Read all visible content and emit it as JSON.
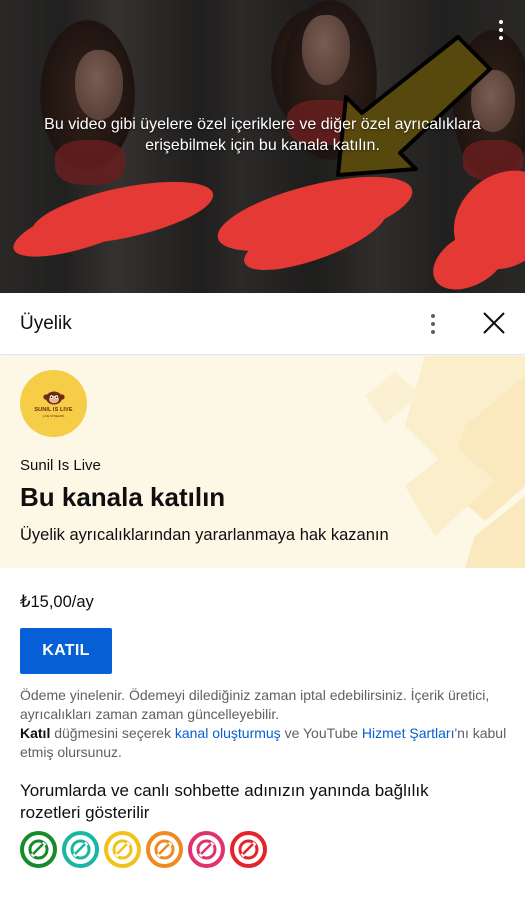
{
  "video": {
    "overlay_message": "Bu video gibi üyelere özel içeriklere ve diğer özel ayrıcalıklara erişebilmek için bu kanala katılın.",
    "more_icon": "more-vertical-icon"
  },
  "panel": {
    "title": "Üyelik",
    "more_icon": "more-vertical-icon",
    "close_icon": "close-icon"
  },
  "channel": {
    "avatar_text": "SUNIL IS LIVE",
    "avatar_subtext": "LIVE STREAMS",
    "name": "Sunil Is Live",
    "join_title": "Bu kanala katılın",
    "join_subtitle": "Üyelik ayrıcalıklarından yararlanmaya hak kazanın",
    "brand_color": "#f6cd46"
  },
  "membership": {
    "price": "₺15,00/ay",
    "join_button": "KATIL",
    "terms_line1": "Ödeme yinelenir. Ödemeyi dilediğiniz zaman iptal edebilirsiniz. İçerik üretici, ayrıcalıkları zaman zaman güncelleyebilir.",
    "terms_bold": "Katıl",
    "terms_mid": " düğmesini seçerek ",
    "terms_link1": "kanal oluşturmuş",
    "terms_mid2": " ve YouTube ",
    "terms_link2": "Hizmet Şartları",
    "terms_end": "'nı kabul etmiş olursunuz.",
    "accent_color": "#065fd4"
  },
  "perks": {
    "badges_title": "Yorumlarda ve canlı sohbette adınızın yanında bağlılık rozetleri gösterilir",
    "badges": [
      {
        "name": "badge-green",
        "color": "#178a2a"
      },
      {
        "name": "badge-teal",
        "color": "#19b6a3"
      },
      {
        "name": "badge-yellow",
        "color": "#f2c21b"
      },
      {
        "name": "badge-orange",
        "color": "#ee8a1f"
      },
      {
        "name": "badge-pink",
        "color": "#e0336e"
      },
      {
        "name": "badge-red",
        "color": "#e3242b"
      }
    ]
  }
}
